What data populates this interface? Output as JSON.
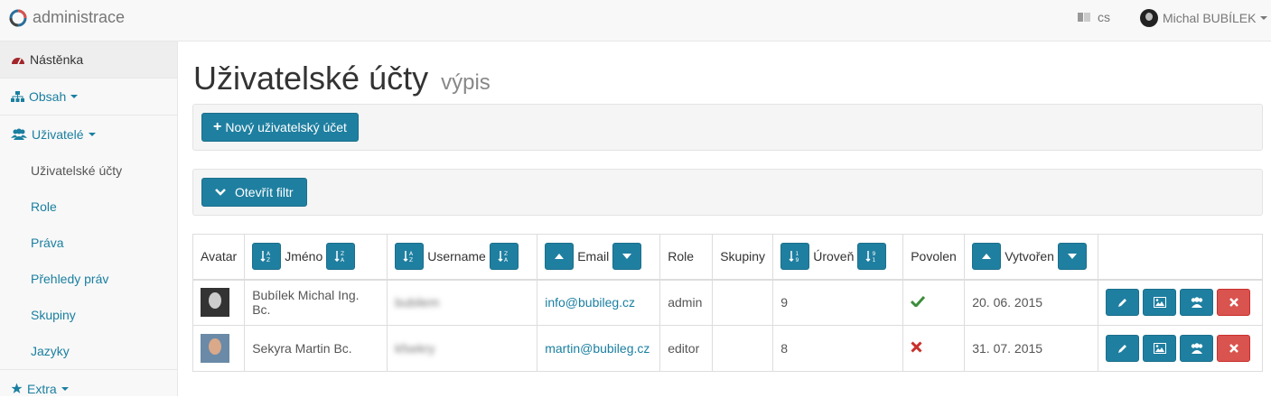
{
  "navbar": {
    "brand": "administrace",
    "language": "cs",
    "user": "Michal BUBÍLEK"
  },
  "sidebar": {
    "items": [
      {
        "label": "Nástěnka",
        "icon": "dashboard-icon"
      },
      {
        "label": "Obsah",
        "icon": "sitemap-icon"
      },
      {
        "label": "Uživatelé",
        "icon": "users-icon"
      }
    ],
    "users_sub": [
      "Uživatelské účty",
      "Role",
      "Práva",
      "Přehledy práv",
      "Skupiny",
      "Jazyky"
    ],
    "extra": {
      "label": "Extra",
      "icon": "star-icon"
    }
  },
  "page": {
    "title": "Uživatelské účty",
    "subtitle": "výpis"
  },
  "toolbar": {
    "new_account": "Nový uživatelský účet",
    "open_filter": "Otevřít filtr"
  },
  "table": {
    "headers": {
      "avatar": "Avatar",
      "name": "Jméno",
      "username": "Username",
      "email": "Email",
      "role": "Role",
      "groups": "Skupiny",
      "level": "Úroveň",
      "enabled": "Povolen",
      "created": "Vytvořen"
    },
    "rows": [
      {
        "name": "Bubílek Michal Ing. Bc.",
        "username": "bubilem",
        "email": "info@bubileg.cz",
        "role": "admin",
        "groups": "",
        "level": "9",
        "enabled": true,
        "created": "20. 06. 2015"
      },
      {
        "name": "Sekyra Martin Bc.",
        "username": "kfsekry",
        "email": "martin@bubileg.cz",
        "role": "editor",
        "groups": "",
        "level": "8",
        "enabled": false,
        "created": "31. 07. 2015"
      }
    ]
  },
  "colors": {
    "primary": "#1f7fa0",
    "danger": "#d9534f",
    "success": "#3c8d3c",
    "fail": "#c9302c"
  }
}
